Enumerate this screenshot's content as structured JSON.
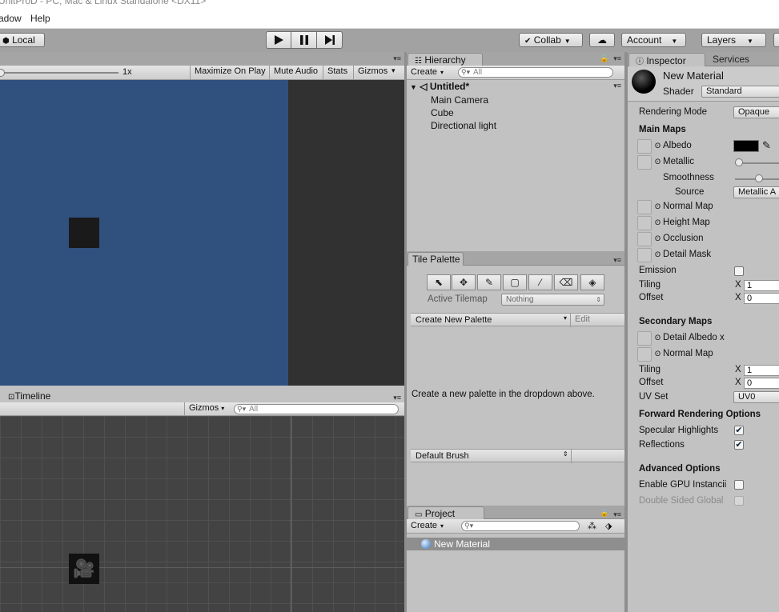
{
  "window_title": "UnitProD - PC, Mac & Linux Standalone <DX11>",
  "menu": [
    "adow",
    "Help"
  ],
  "toolbar": {
    "local": "Local",
    "collab": "Collab",
    "account": "Account",
    "layers": "Layers"
  },
  "game": {
    "scale": "1x",
    "buttons": [
      "Maximize On Play",
      "Mute Audio",
      "Stats",
      "Gizmos"
    ]
  },
  "timeline": {
    "tab": "Timeline",
    "gizmos": "Gizmos",
    "search_placeholder": "All"
  },
  "hierarchy": {
    "tab": "Hierarchy",
    "create": "Create",
    "search_placeholder": "All",
    "scene": "Untitled*",
    "items": [
      "Main Camera",
      "Cube",
      "Directional light"
    ]
  },
  "tile_palette": {
    "tab": "Tile Palette",
    "active_tilemap_label": "Active Tilemap",
    "active_tilemap_value": "Nothing",
    "palette_select": "Create New Palette",
    "edit": "Edit",
    "empty_message": "Create a new palette in the dropdown above.",
    "brush": "Default Brush"
  },
  "project": {
    "tab": "Project",
    "create": "Create",
    "items": [
      "New Material"
    ]
  },
  "inspector": {
    "tab": "Inspector",
    "services_tab": "Services",
    "material_name": "New Material",
    "shader_label": "Shader",
    "shader_value": "Standard",
    "rendering_mode_label": "Rendering Mode",
    "rendering_mode_value": "Opaque",
    "main_maps": "Main Maps",
    "albedo": "Albedo",
    "albedo_color": "#000000",
    "metallic": "Metallic",
    "metallic_value": 0.0,
    "smoothness": "Smoothness",
    "smoothness_value": 0.5,
    "source": "Source",
    "source_value": "Metallic A",
    "normal_map": "Normal Map",
    "height_map": "Height Map",
    "occlusion": "Occlusion",
    "detail_mask": "Detail Mask",
    "emission": "Emission",
    "tiling": "Tiling",
    "offset": "Offset",
    "x": "X",
    "tiling_x": "1",
    "offset_x": "0",
    "secondary_maps": "Secondary Maps",
    "detail_albedo": "Detail Albedo x",
    "normal_map_2": "Normal Map",
    "tiling_2": "Tiling",
    "offset_2": "Offset",
    "tiling_x_2": "1",
    "offset_x_2": "0",
    "uv_set": "UV Set",
    "uv_set_value": "UV0",
    "forward_rendering": "Forward Rendering Options",
    "specular_highlights": "Specular Highlights",
    "reflections": "Reflections",
    "advanced": "Advanced Options",
    "gpu_instancing": "Enable GPU Instancii",
    "double_sided": "Double Sided Global"
  },
  "colors": {
    "game_bg": "#30507e",
    "timeline_bg": "#434343",
    "panel_bg": "#c2c2c2"
  }
}
